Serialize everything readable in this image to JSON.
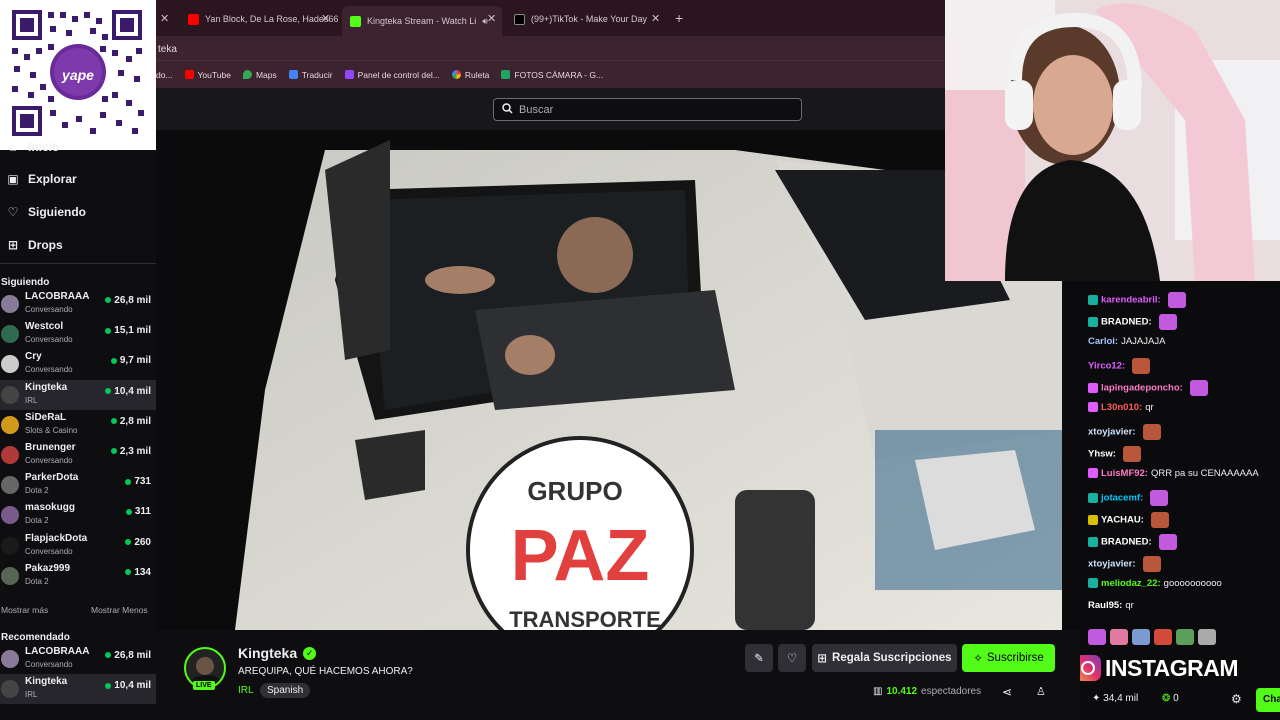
{
  "browser": {
    "tabs": [
      {
        "label": "Yan Block, De La Rose, Hades66",
        "icon": "youtube-icon",
        "color": "#ff0000"
      },
      {
        "label": "Kingteka Stream - Watch Li",
        "icon": "kick-icon",
        "color": "#53fc18"
      },
      {
        "label": "(99+)TikTok - Make Your Day",
        "icon": "tiktok-icon",
        "color": "#ffffff"
      }
    ],
    "new_tab": "+",
    "address_text": "teka",
    "bookmarks": [
      {
        "label": "do...",
        "color": "#888888"
      },
      {
        "label": "YouTube",
        "color": "#ff0000"
      },
      {
        "label": "Maps",
        "color": "#34a853"
      },
      {
        "label": "Traducir",
        "color": "#4285f4"
      },
      {
        "label": "Panel de control del...",
        "color": "#9146ff"
      },
      {
        "label": "Ruleta",
        "color": "#f4b400"
      },
      {
        "label": "FOTOS CÁMARA - G...",
        "color": "#1fa463"
      }
    ]
  },
  "qr": {
    "brand": "yape"
  },
  "search": {
    "placeholder": "Buscar"
  },
  "sidebar": {
    "nav": [
      {
        "label": "Inicio",
        "icon": "home-icon"
      },
      {
        "label": "Explorar",
        "icon": "compass-icon"
      },
      {
        "label": "Siguiendo",
        "icon": "heart-icon"
      },
      {
        "label": "Drops",
        "icon": "gift-icon"
      }
    ],
    "following_title": "Siguiendo",
    "following": [
      {
        "name": "LACOBRAAA",
        "game": "Conversando",
        "viewers": "26,8 mil",
        "color": "#8a7a9a"
      },
      {
        "name": "Westcol",
        "game": "Conversando",
        "viewers": "15,1 mil",
        "color": "#2e6b4f"
      },
      {
        "name": "Cry",
        "game": "Conversando",
        "viewers": "9,7 mil",
        "color": "#cccccc"
      },
      {
        "name": "Kingteka",
        "game": "IRL",
        "viewers": "10,4 mil",
        "color": "#444444"
      },
      {
        "name": "SiDeRaL",
        "game": "Slots & Casino",
        "viewers": "2,8 mil",
        "color": "#d19a1a"
      },
      {
        "name": "Brunenger",
        "game": "Conversando",
        "viewers": "2,3 mil",
        "color": "#b03a3a"
      },
      {
        "name": "ParkerDota",
        "game": "Dota 2",
        "viewers": "731",
        "color": "#666666"
      },
      {
        "name": "masokugg",
        "game": "Dota 2",
        "viewers": "311",
        "color": "#7a5a8a"
      },
      {
        "name": "FlapjackDota",
        "game": "Conversando",
        "viewers": "260",
        "color": "#1a1a1a"
      },
      {
        "name": "Pakaz999",
        "game": "Dota 2",
        "viewers": "134",
        "color": "#556655"
      }
    ],
    "show_more": "Mostrar más",
    "show_less": "Mostrar Menos",
    "recommended_title": "Recomendado",
    "recommended": [
      {
        "name": "LACOBRAAA",
        "game": "Conversando",
        "viewers": "26,8 mil",
        "color": "#8a7a9a"
      },
      {
        "name": "Kingteka",
        "game": "IRL",
        "viewers": "10,4 mil",
        "color": "#444444"
      }
    ]
  },
  "video": {
    "truck_logo_line1": "GRUPO",
    "truck_logo_line2": "PAZ",
    "truck_logo_line3": "TRANSPORTE"
  },
  "chat": {
    "messages": [
      {
        "user": "karendeabril:",
        "text": "",
        "color": "#e05cff",
        "badge": "#1ab0a0"
      },
      {
        "user": "BRADNED:",
        "text": "",
        "color": "#ffffff",
        "badge": "#1ab0a0"
      },
      {
        "user": "Carloi:",
        "text": "JAJAJAJA",
        "color": "#a6c8ff",
        "badge": ""
      },
      {
        "user": "Yirco12:",
        "text": "",
        "color": "#e05cff",
        "badge": ""
      },
      {
        "user": "lapingadeponcho:",
        "text": "",
        "color": "#ff7ac6",
        "badge": "#e05cff"
      },
      {
        "user": "L30n010:",
        "text": "qr",
        "color": "#ff5b5b",
        "badge": "#e05cff"
      },
      {
        "user": "xtoyjavier:",
        "text": "",
        "color": "#cfe4ff",
        "badge": ""
      },
      {
        "user": "Yhsw:",
        "text": "",
        "color": "#ffffff",
        "badge": ""
      },
      {
        "user": "LuisMF92:",
        "text": "QRR pa su CENAAAAAA",
        "color": "#ff7ac6",
        "badge": "#e05cff"
      },
      {
        "user": "jotacemf:",
        "text": "",
        "color": "#00c8ff",
        "badge": "#1ab0a0"
      },
      {
        "user": "YACHAU:",
        "text": "",
        "color": "#ffffff",
        "badge": "#d6c000"
      },
      {
        "user": "BRADNED:",
        "text": "",
        "color": "#ffffff",
        "badge": "#1ab0a0"
      },
      {
        "user": "xtoyjavier:",
        "text": "",
        "color": "#cfe4ff",
        "badge": ""
      },
      {
        "user": "meliodaz_22:",
        "text": "goooooooooo",
        "color": "#53fc18",
        "badge": "#1ab0a0"
      },
      {
        "user": "Raul95:",
        "text": "qr",
        "color": "#ffffff",
        "badge": ""
      }
    ],
    "instagram_label": "INSTAGRAM",
    "points": "34,4 mil",
    "coins": "0",
    "chat_button": "Cha"
  },
  "stream": {
    "channel": "Kingteka",
    "live_badge": "LIVE",
    "title": "AREQUIPA, QUÉ HACEMOS AHORA?",
    "category": "IRL",
    "language_tag": "Spanish",
    "gift_subs": "Regala Suscripciones",
    "subscribe": "Suscribirse",
    "viewers": "10.412",
    "viewers_label": "espectadores"
  },
  "colors": {
    "accent": "#53fc18",
    "live_dot": "#00c85a"
  }
}
